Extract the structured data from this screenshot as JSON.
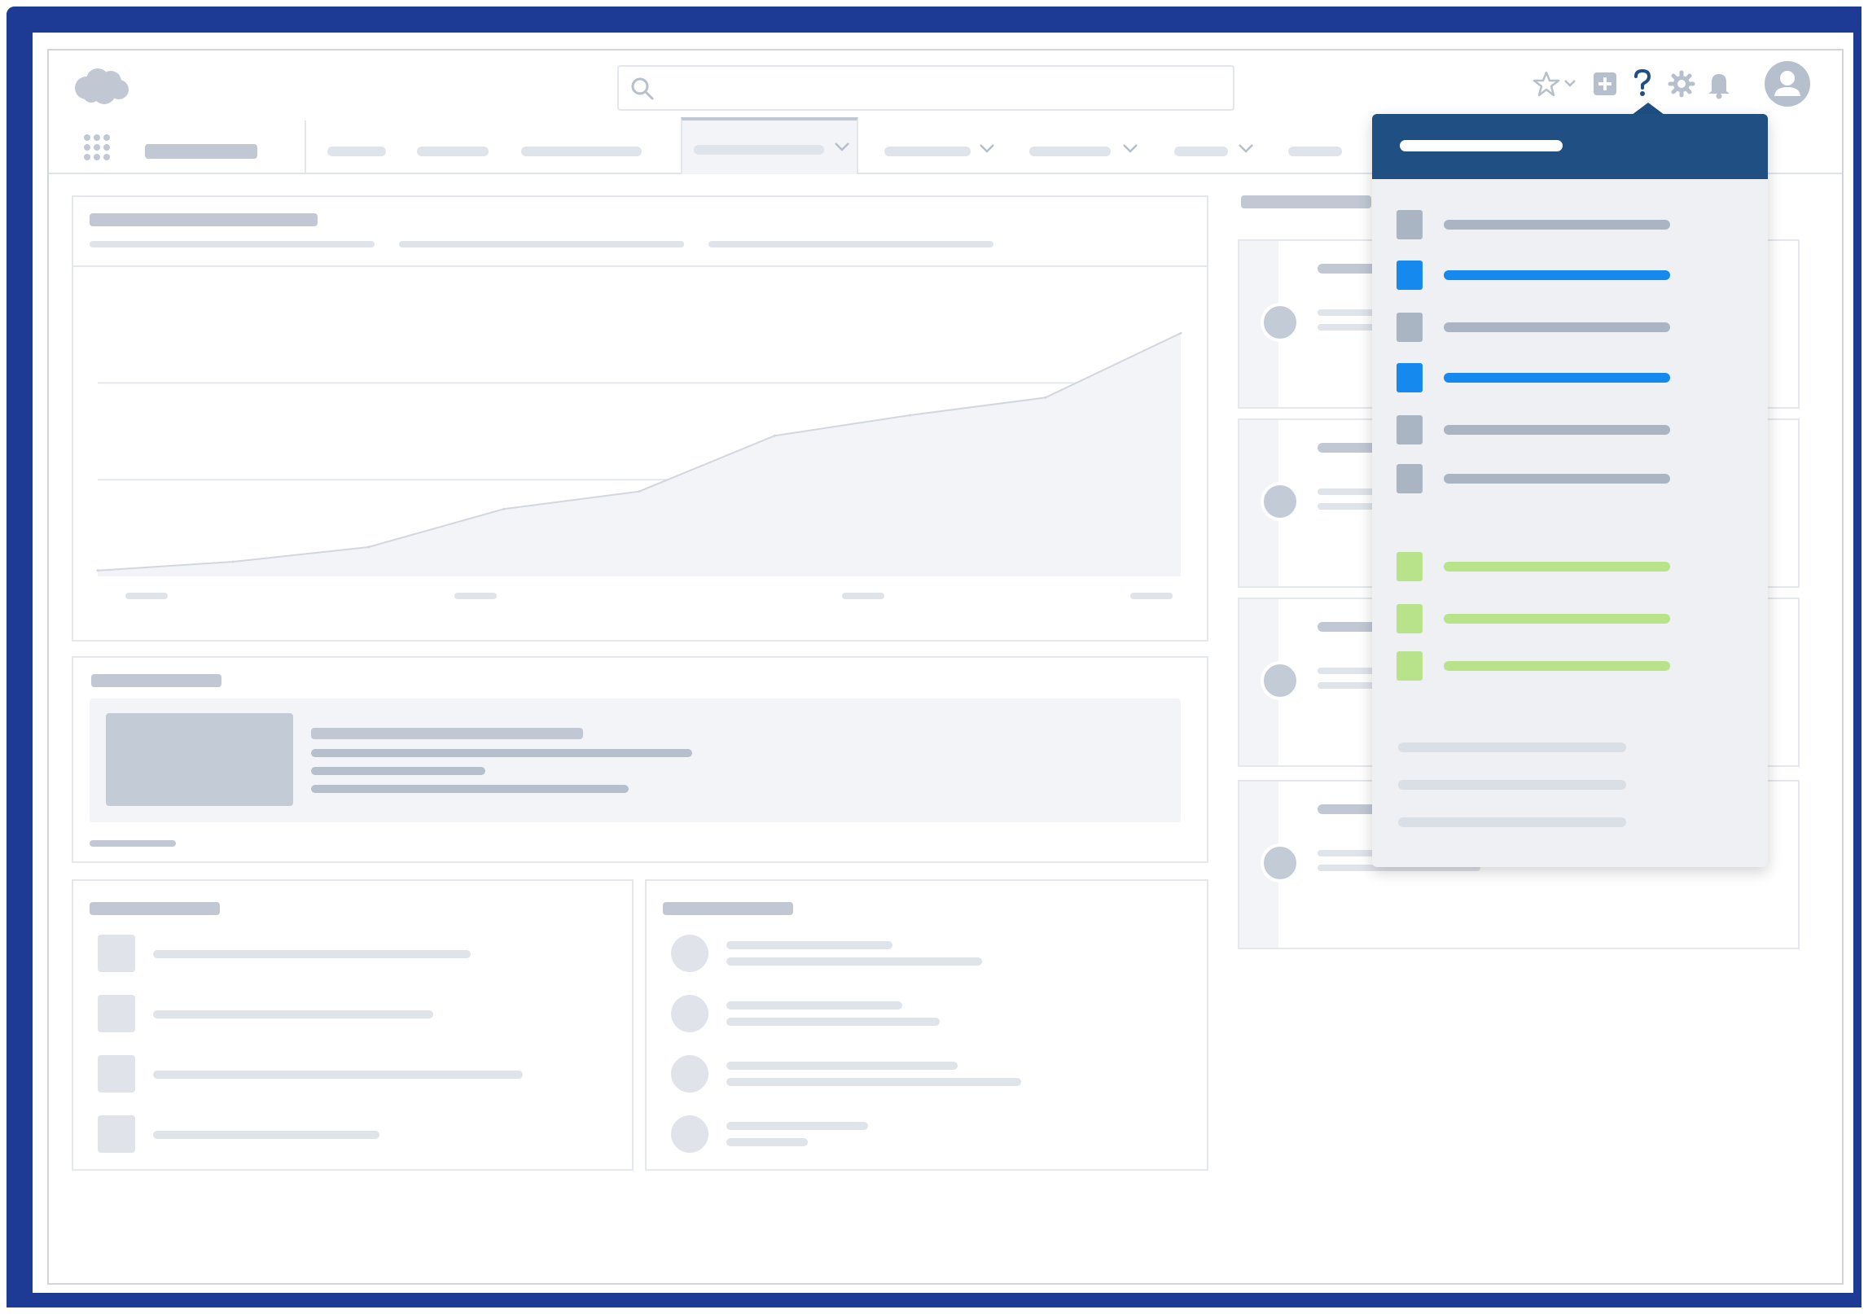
{
  "colors": {
    "frame_border": "#1d3a94",
    "dropdown_header": "#1f4f83",
    "accent_blue": "#1589ee",
    "accent_green": "#b8e38a",
    "placeholder_gray": "#c1c8d3"
  },
  "header": {
    "logo": "cloud-logo-icon",
    "search": {
      "placeholder": "",
      "icon": "search-icon"
    },
    "actions": [
      "star-icon",
      "chevron-down-icon",
      "add-icon",
      "help-icon",
      "gear-icon",
      "bell-icon",
      "avatar-icon"
    ]
  },
  "nav": {
    "app_launcher_icon": "grid-icon",
    "active_tab_index": 3,
    "tabs_with_dropdown": [
      3,
      4,
      5,
      6
    ]
  },
  "help_menu": {
    "open": true,
    "item_colors": [
      "gray",
      "blue",
      "gray",
      "blue",
      "gray",
      "gray",
      "green",
      "green",
      "green"
    ]
  },
  "chart_data": {
    "type": "area",
    "x": [
      0,
      1,
      2,
      3,
      4,
      5,
      6,
      7,
      8
    ],
    "values": [
      2,
      5,
      10,
      23,
      29,
      48,
      55,
      61,
      83
    ],
    "ylim": [
      0,
      100
    ],
    "grid": true
  }
}
